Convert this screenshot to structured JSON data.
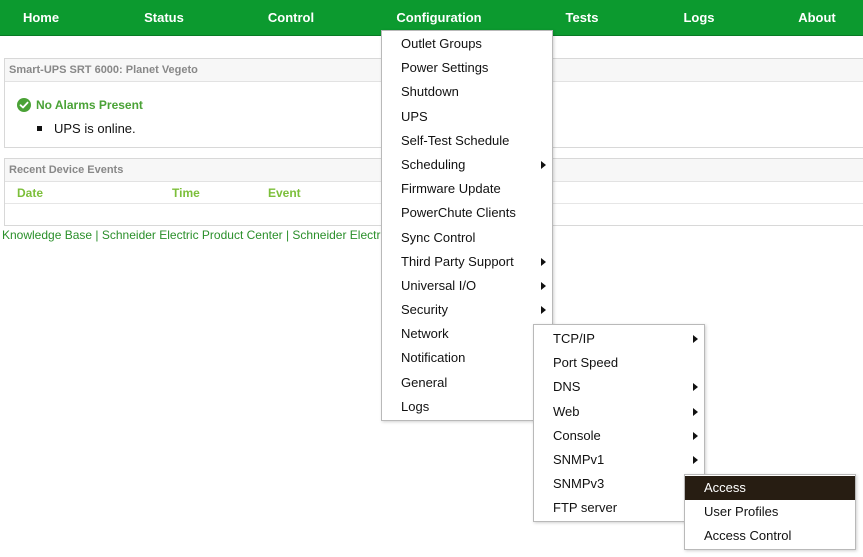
{
  "nav": {
    "items": [
      {
        "label": "Home"
      },
      {
        "label": "Status"
      },
      {
        "label": "Control"
      },
      {
        "label": "Configuration"
      },
      {
        "label": "Tests"
      },
      {
        "label": "Logs"
      },
      {
        "label": "About"
      }
    ]
  },
  "status_panel": {
    "title": "Smart-UPS SRT 6000: Planet Vegeto",
    "alarm_text": "No Alarms Present",
    "status_text": "UPS is online."
  },
  "events_panel": {
    "title": "Recent Device Events",
    "columns": [
      "Date",
      "Time",
      "Event"
    ]
  },
  "footer": {
    "links": [
      "Knowledge Base",
      "Schneider Electric Product Center",
      "Schneider Electr"
    ],
    "separator": "|"
  },
  "config_menu": {
    "items": [
      {
        "label": "Outlet Groups",
        "submenu": false
      },
      {
        "label": "Power Settings",
        "submenu": false
      },
      {
        "label": "Shutdown",
        "submenu": false
      },
      {
        "label": "UPS",
        "submenu": false
      },
      {
        "label": "Self-Test Schedule",
        "submenu": false
      },
      {
        "label": "Scheduling",
        "submenu": true
      },
      {
        "label": "Firmware Update",
        "submenu": false
      },
      {
        "label": "PowerChute Clients",
        "submenu": false
      },
      {
        "label": "Sync Control",
        "submenu": false
      },
      {
        "label": "Third Party Support",
        "submenu": true
      },
      {
        "label": "Universal I/O",
        "submenu": true
      },
      {
        "label": "Security",
        "submenu": true
      },
      {
        "label": "Network",
        "submenu": true
      },
      {
        "label": "Notification",
        "submenu": false
      },
      {
        "label": "General",
        "submenu": false
      },
      {
        "label": "Logs",
        "submenu": false
      }
    ]
  },
  "network_menu": {
    "items": [
      {
        "label": "TCP/IP",
        "submenu": true
      },
      {
        "label": "Port Speed",
        "submenu": false
      },
      {
        "label": "DNS",
        "submenu": true
      },
      {
        "label": "Web",
        "submenu": true
      },
      {
        "label": "Console",
        "submenu": true
      },
      {
        "label": "SNMPv1",
        "submenu": true
      },
      {
        "label": "SNMPv3",
        "submenu": true
      },
      {
        "label": "FTP server",
        "submenu": false
      }
    ]
  },
  "snmpv3_menu": {
    "items": [
      {
        "label": "Access",
        "active": true
      },
      {
        "label": "User Profiles",
        "active": false
      },
      {
        "label": "Access Control",
        "active": false
      }
    ]
  },
  "colors": {
    "nav_bg": "#0c9a2f",
    "accent_green": "#4aa236",
    "menu_highlight": "#271d12"
  }
}
